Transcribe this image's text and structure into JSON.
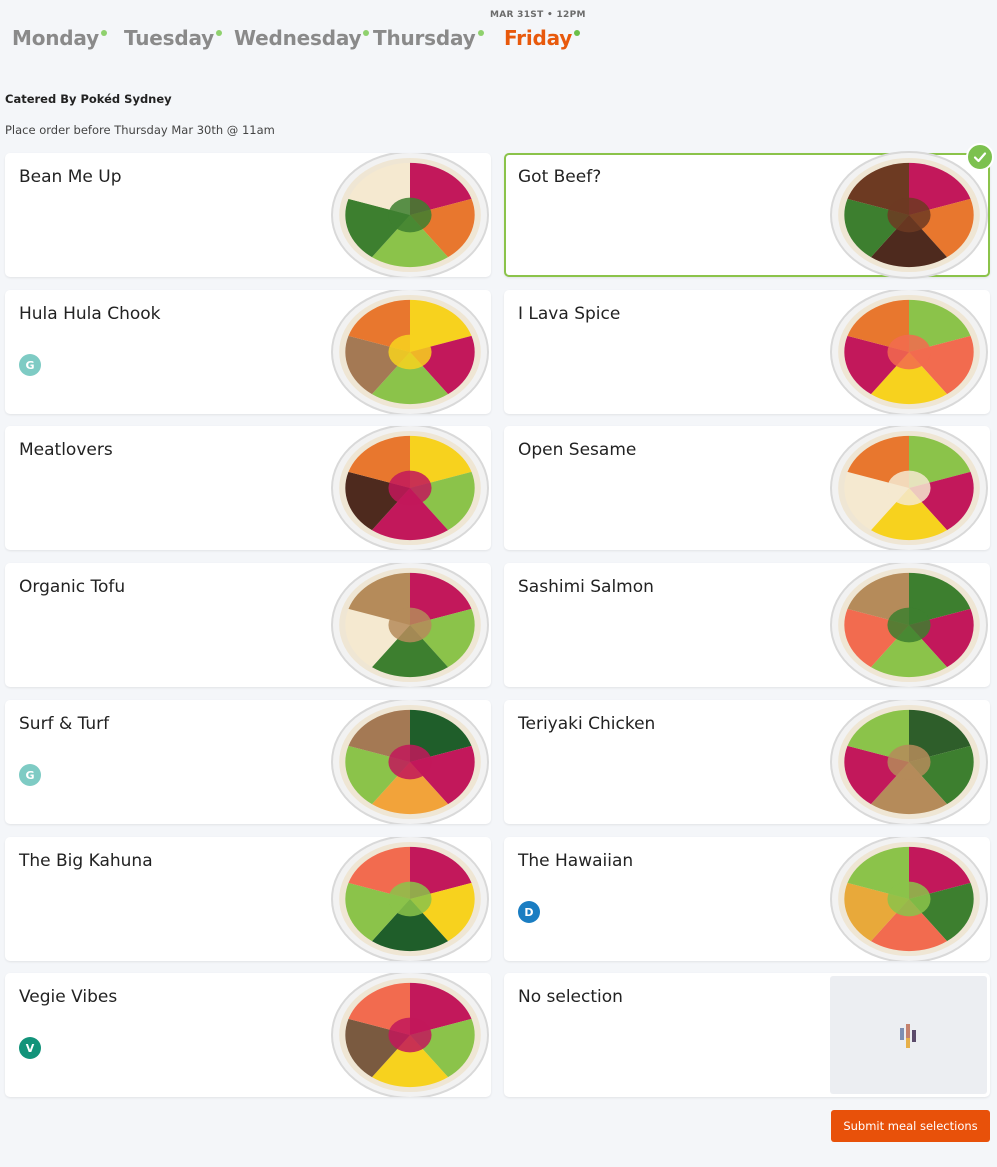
{
  "days": [
    {
      "label": "Monday",
      "active": false
    },
    {
      "label": "Tuesday",
      "active": false
    },
    {
      "label": "Wednesday",
      "active": false
    },
    {
      "label": "Thursday",
      "active": false
    },
    {
      "label": "Friday",
      "active": true,
      "date": "MAR 31ST • 12PM"
    }
  ],
  "caterer": "Catered By Pokéd Sydney",
  "deadline": "Place order before Thursday Mar 30th @ 11am",
  "meals": [
    {
      "name": "Bean Me Up",
      "badge": null,
      "selected": false
    },
    {
      "name": "Got Beef?",
      "badge": null,
      "selected": true
    },
    {
      "name": "Hula Hula Chook",
      "badge": "G",
      "selected": false
    },
    {
      "name": "I Lava Spice",
      "badge": null,
      "selected": false
    },
    {
      "name": "Meatlovers",
      "badge": null,
      "selected": false
    },
    {
      "name": "Open Sesame",
      "badge": null,
      "selected": false
    },
    {
      "name": "Organic Tofu",
      "badge": null,
      "selected": false
    },
    {
      "name": "Sashimi Salmon",
      "badge": null,
      "selected": false
    },
    {
      "name": "Surf & Turf",
      "badge": "G",
      "selected": false
    },
    {
      "name": "Teriyaki Chicken",
      "badge": null,
      "selected": false
    },
    {
      "name": "The Big Kahuna",
      "badge": null,
      "selected": false
    },
    {
      "name": "The Hawaiian",
      "badge": "D",
      "selected": false
    },
    {
      "name": "Vegie Vibes",
      "badge": "V",
      "selected": false
    },
    {
      "name": "No selection",
      "badge": null,
      "selected": false,
      "placeholder": true
    }
  ],
  "badge_colors": {
    "G": "#7ecbc4",
    "D": "#1a7dc2",
    "V": "#12937a"
  },
  "submit_label": "Submit meal selections",
  "colors": {
    "accent": "#e8590c",
    "selected_border": "#8bc34a",
    "button": "#e8510a"
  }
}
